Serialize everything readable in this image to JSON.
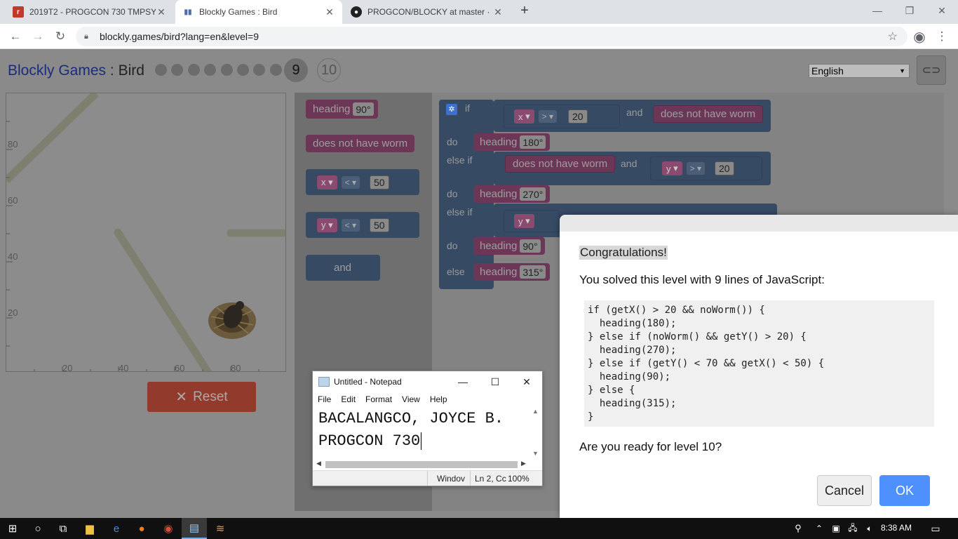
{
  "browser": {
    "tabs": [
      {
        "title": "2019T2 - PROGCON 730 TMPSY |",
        "icon": "classroom-icon"
      },
      {
        "title": "Blockly Games : Bird",
        "icon": "blockly-icon",
        "active": true
      },
      {
        "title": "PROGCON/BLOCKY at master · Jo",
        "icon": "github-icon"
      }
    ],
    "new_tab": "+",
    "url": "blockly.games/bird?lang=en&level=9"
  },
  "header": {
    "app_name": "Blockly Games",
    "separator": " : ",
    "game": "Bird",
    "levels_completed": 8,
    "current_level": "9",
    "next_level": "10",
    "language": "English"
  },
  "visual": {
    "y_ticks": [
      "80",
      "60",
      "40",
      "20"
    ],
    "x_ticks": [
      "20",
      "40",
      "60",
      "80"
    ]
  },
  "reset_label": "Reset",
  "toolbox": {
    "heading": "heading",
    "heading_val": "90°",
    "no_worm": "does not have worm",
    "x_var": "x",
    "lt": "<",
    "x_val": "50",
    "y_var": "y",
    "y_val": "50",
    "and": "and"
  },
  "workspace": {
    "if": "if",
    "do": "do",
    "else_if": "else if",
    "else": "else",
    "and": "and",
    "gt": ">",
    "lt": "<",
    "x": "x",
    "y": "y",
    "v20": "20",
    "no_worm": "does not have worm",
    "heading": "heading",
    "h1": "180°",
    "h2": "270°",
    "h3": "90°",
    "h4": "315°"
  },
  "dialog": {
    "title": "Congratulations!",
    "message": "You solved this level with 9 lines of JavaScript:",
    "code": [
      "if (getX() > 20 && noWorm()) {",
      "  heading(180);",
      "} else if (noWorm() && getY() > 20) {",
      "  heading(270);",
      "} else if (getY() < 70 && getX() < 50) {",
      "  heading(90);",
      "} else {",
      "  heading(315);",
      "}"
    ],
    "question": "Are you ready for level 10?",
    "cancel": "Cancel",
    "ok": "OK"
  },
  "notepad": {
    "title": "Untitled - Notepad",
    "menu": [
      "File",
      "Edit",
      "Format",
      "View",
      "Help"
    ],
    "line1": "BACALANGCO, JOYCE B.",
    "line2": "PROGCON 730",
    "status_window": "Windov",
    "status_pos": "Ln 2, Cc",
    "status_zoom": "100%"
  },
  "taskbar": {
    "time": "8:38 AM"
  }
}
